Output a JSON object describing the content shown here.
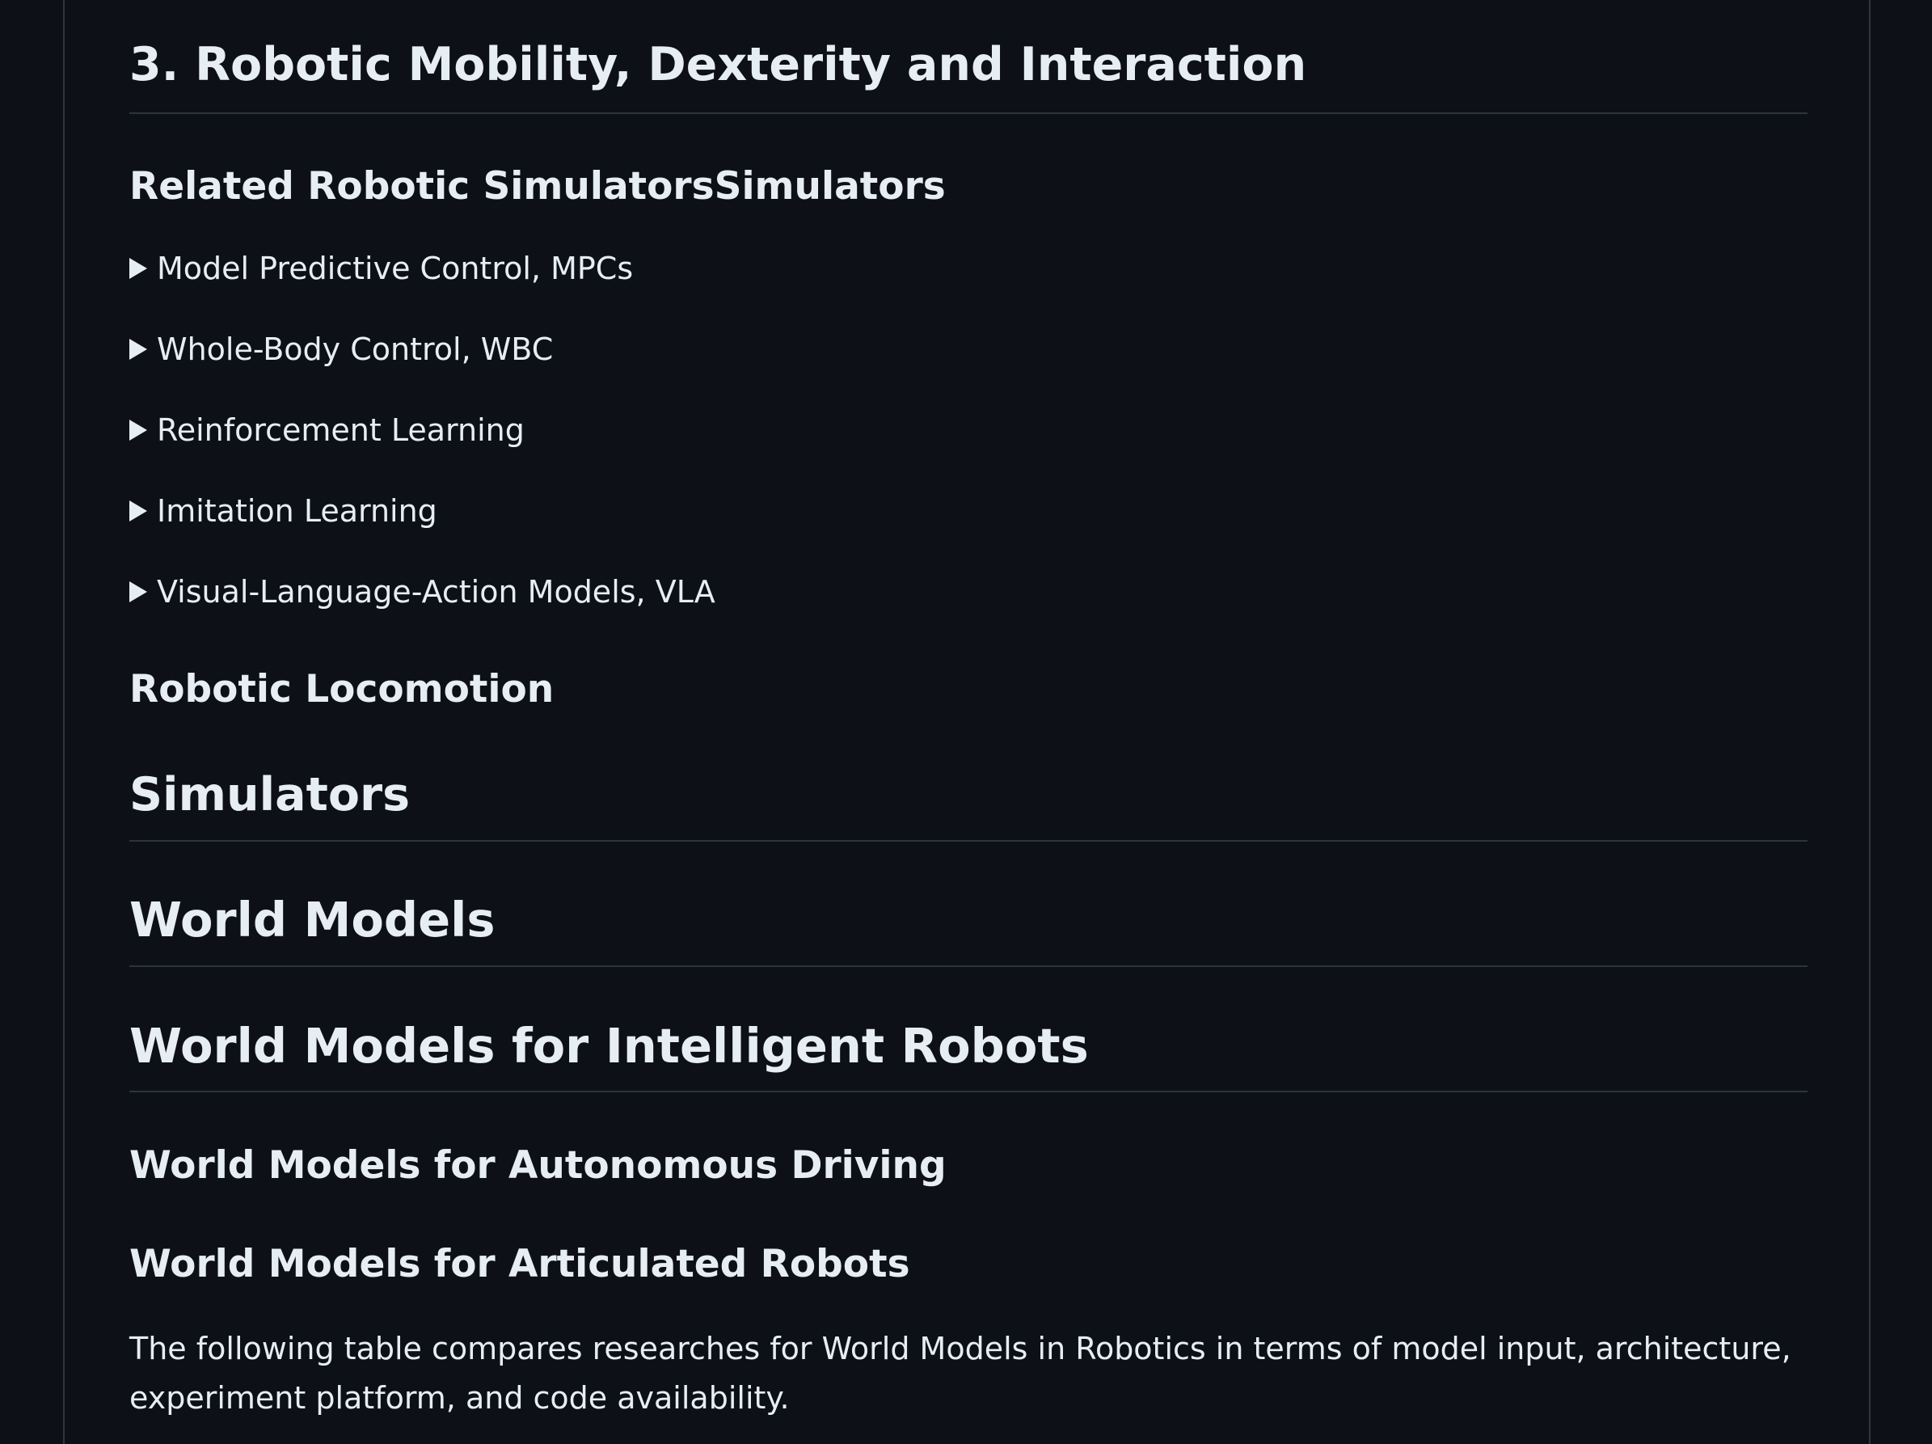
{
  "sections": {
    "heading_3": "3. Robotic Mobility, Dexterity and Interaction",
    "related_sims": "Related Robotic SimulatorsSimulators",
    "details": [
      "Model Predictive Control, MPCs",
      "Whole-Body Control, WBC",
      "Reinforcement Learning",
      "Imitation Learning",
      "Visual-Language-Action Models, VLA"
    ],
    "locomotion": "Robotic Locomotion",
    "simulators": "Simulators",
    "world_models": "World Models",
    "wm_intelligent": "World Models for Intelligent Robots",
    "wm_autonomous": "World Models for Autonomous Driving",
    "wm_articulated": "World Models for Articulated Robots",
    "intro_paragraph": "The following table compares researches for World Models in Robotics in terms of model input, architecture, experiment platform, and code availability."
  },
  "colors": {
    "background": "#0d1117",
    "text": "#e6edf3",
    "rule": "#2d333b",
    "frame": "#30363d"
  }
}
